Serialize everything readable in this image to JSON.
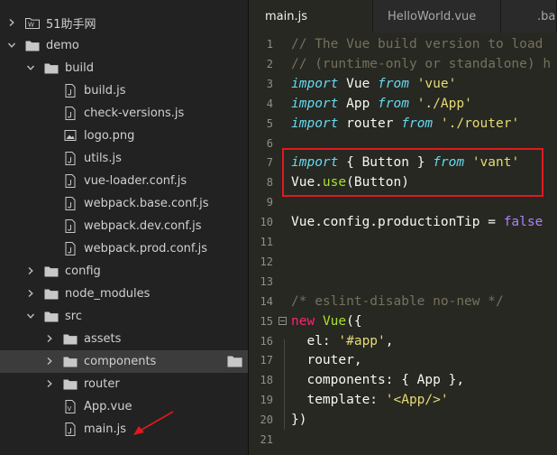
{
  "sidebar": {
    "items": [
      {
        "label": "51助手网",
        "depth": 0,
        "expanded": false,
        "type": "wp-folder"
      },
      {
        "label": "demo",
        "depth": 0,
        "expanded": true,
        "type": "folder"
      },
      {
        "label": "build",
        "depth": 1,
        "expanded": true,
        "type": "folder"
      },
      {
        "label": "build.js",
        "depth": 2,
        "type": "file"
      },
      {
        "label": "check-versions.js",
        "depth": 2,
        "type": "file"
      },
      {
        "label": "logo.png",
        "depth": 2,
        "type": "image"
      },
      {
        "label": "utils.js",
        "depth": 2,
        "type": "file"
      },
      {
        "label": "vue-loader.conf.js",
        "depth": 2,
        "type": "file"
      },
      {
        "label": "webpack.base.conf.js",
        "depth": 2,
        "type": "file"
      },
      {
        "label": "webpack.dev.conf.js",
        "depth": 2,
        "type": "file"
      },
      {
        "label": "webpack.prod.conf.js",
        "depth": 2,
        "type": "file"
      },
      {
        "label": "config",
        "depth": 1,
        "expanded": false,
        "type": "folder"
      },
      {
        "label": "node_modules",
        "depth": 1,
        "expanded": false,
        "type": "folder"
      },
      {
        "label": "src",
        "depth": 1,
        "expanded": true,
        "type": "folder"
      },
      {
        "label": "assets",
        "depth": 2,
        "expanded": false,
        "type": "folder"
      },
      {
        "label": "components",
        "depth": 2,
        "expanded": false,
        "type": "folder",
        "selected": true
      },
      {
        "label": "router",
        "depth": 2,
        "expanded": false,
        "type": "folder"
      },
      {
        "label": "App.vue",
        "depth": 2,
        "type": "vue"
      },
      {
        "label": "main.js",
        "depth": 2,
        "type": "file"
      }
    ]
  },
  "tabs": [
    {
      "label": "main.js",
      "active": true
    },
    {
      "label": "HelloWorld.vue",
      "active": false
    },
    {
      "label": ".bab",
      "active": false
    }
  ],
  "editor": {
    "lines": [
      {
        "n": "1",
        "tokens": [
          [
            "cm",
            "// The Vue build version to load"
          ]
        ]
      },
      {
        "n": "2",
        "tokens": [
          [
            "cm",
            "// (runtime-only or standalone) h"
          ]
        ]
      },
      {
        "n": "3",
        "tokens": [
          [
            "kw",
            "import"
          ],
          [
            "pl",
            " Vue "
          ],
          [
            "kw",
            "from"
          ],
          [
            "pl",
            " "
          ],
          [
            "st",
            "'vue'"
          ]
        ]
      },
      {
        "n": "4",
        "tokens": [
          [
            "kw",
            "import"
          ],
          [
            "pl",
            " App "
          ],
          [
            "kw",
            "from"
          ],
          [
            "pl",
            " "
          ],
          [
            "st",
            "'./App'"
          ]
        ]
      },
      {
        "n": "5",
        "tokens": [
          [
            "kw",
            "import"
          ],
          [
            "pl",
            " router "
          ],
          [
            "kw",
            "from"
          ],
          [
            "pl",
            " "
          ],
          [
            "st",
            "'./router'"
          ]
        ]
      },
      {
        "n": "6",
        "tokens": []
      },
      {
        "n": "7",
        "tokens": [
          [
            "kw",
            "import"
          ],
          [
            "pl",
            " { Button } "
          ],
          [
            "kw",
            "from"
          ],
          [
            "pl",
            " "
          ],
          [
            "st",
            "'vant'"
          ]
        ]
      },
      {
        "n": "8",
        "tokens": [
          [
            "pl",
            "Vue."
          ],
          [
            "fn",
            "use"
          ],
          [
            "pl",
            "(Button)"
          ]
        ]
      },
      {
        "n": "9",
        "tokens": []
      },
      {
        "n": "10",
        "tokens": [
          [
            "pl",
            "Vue.config.productionTip = "
          ],
          [
            "bo",
            "false"
          ]
        ]
      },
      {
        "n": "11",
        "tokens": []
      },
      {
        "n": "12",
        "tokens": []
      },
      {
        "n": "13",
        "tokens": []
      },
      {
        "n": "14",
        "tokens": [
          [
            "cm",
            "/* eslint-disable no-new */"
          ]
        ]
      },
      {
        "n": "15",
        "fold": true,
        "tokens": [
          [
            "kr",
            "new"
          ],
          [
            "pl",
            " "
          ],
          [
            "fn",
            "Vue"
          ],
          [
            "pl",
            "({"
          ]
        ]
      },
      {
        "n": "16",
        "tokens": [
          [
            "pl",
            "  el: "
          ],
          [
            "st",
            "'#app'"
          ],
          [
            "pl",
            ","
          ]
        ]
      },
      {
        "n": "17",
        "tokens": [
          [
            "pl",
            "  router,"
          ]
        ]
      },
      {
        "n": "18",
        "tokens": [
          [
            "pl",
            "  components: { App },"
          ]
        ]
      },
      {
        "n": "19",
        "tokens": [
          [
            "pl",
            "  template: "
          ],
          [
            "st",
            "'<App/>'"
          ]
        ]
      },
      {
        "n": "20",
        "tokens": [
          [
            "pl",
            "})"
          ]
        ]
      },
      {
        "n": "21",
        "tokens": []
      }
    ]
  },
  "colors": {
    "highlight_box": "#e0191f",
    "arrow": "#e0191f"
  }
}
